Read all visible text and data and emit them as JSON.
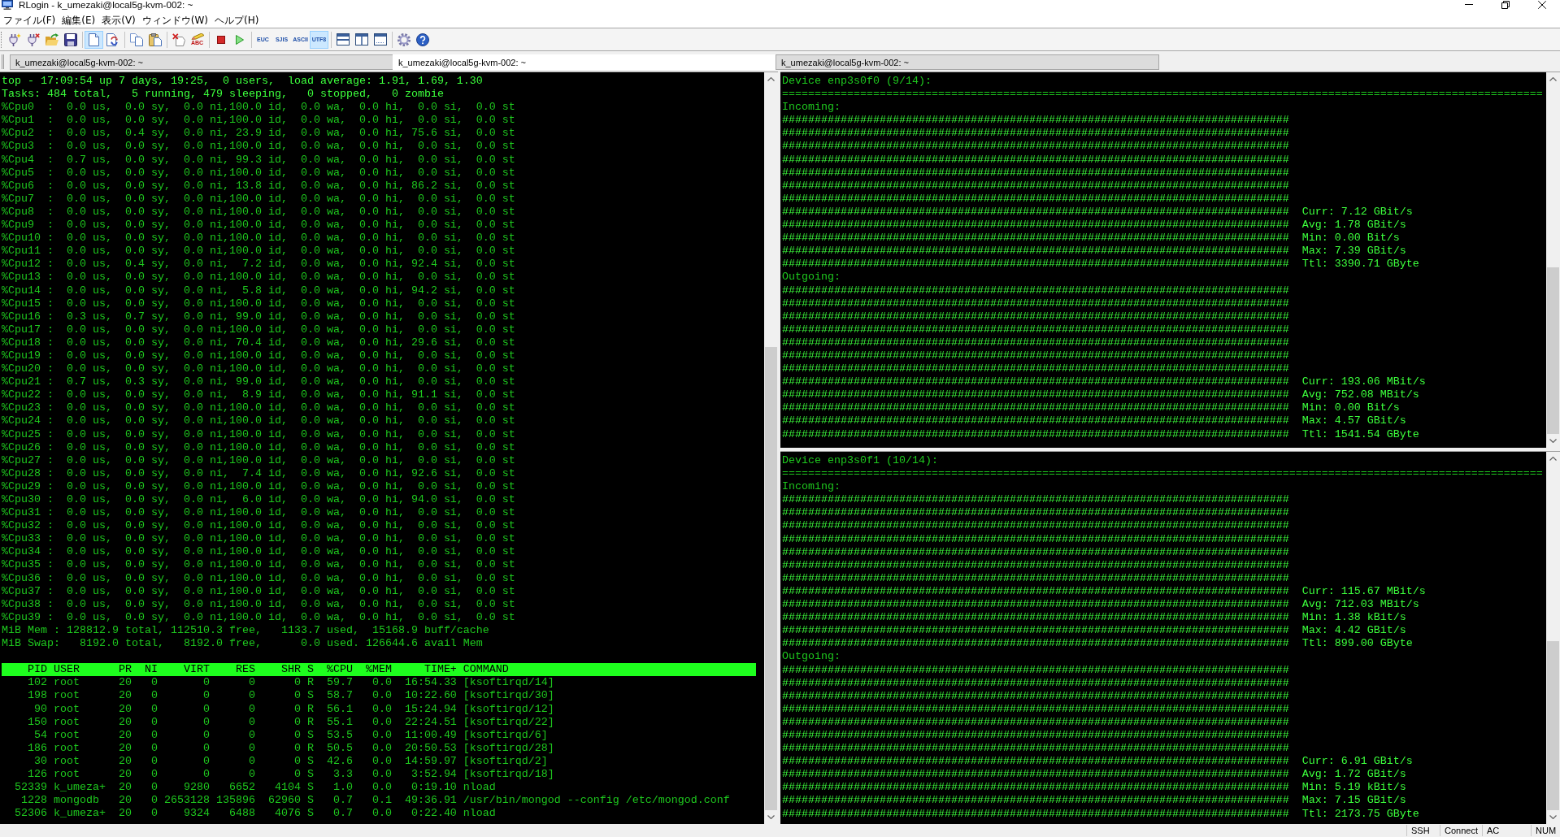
{
  "window": {
    "title": "RLogin - k_umezaki@local5g-kvm-002: ~"
  },
  "menu": [
    "ファイル(F)",
    "編集(E)",
    "表示(V)",
    "ウィンドウ(W)",
    "ヘルプ(H)"
  ],
  "toolbar": [
    {
      "buttons": [
        {
          "kind": "icon",
          "pressed": false
        },
        {
          "kind": "icon",
          "pressed": false
        },
        {
          "kind": "icon",
          "pressed": false
        },
        {
          "kind": "icon",
          "pressed": false
        }
      ]
    },
    {
      "buttons": [
        {
          "kind": "icon",
          "pressed": true
        },
        {
          "kind": "icon",
          "pressed": false
        }
      ]
    },
    {
      "buttons": [
        {
          "kind": "icon",
          "pressed": false
        },
        {
          "kind": "icon",
          "pressed": false
        }
      ]
    },
    {
      "buttons": [
        {
          "kind": "icon",
          "pressed": false
        },
        {
          "kind": "icon",
          "label": "ABC",
          "pressed": false
        }
      ]
    },
    {
      "buttons": [
        {
          "kind": "icon",
          "pressed": false
        },
        {
          "kind": "icon",
          "pressed": false
        }
      ]
    },
    {
      "buttons": [
        {
          "kind": "label",
          "label": "EUC",
          "pressed": false
        },
        {
          "kind": "label",
          "label": "SJIS",
          "pressed": false
        },
        {
          "kind": "label",
          "label": "ASCII",
          "pressed": false
        },
        {
          "kind": "label",
          "label": "UTF8",
          "pressed": true
        }
      ]
    },
    {
      "buttons": [
        {
          "kind": "icon",
          "pressed": false
        },
        {
          "kind": "icon",
          "pressed": false
        },
        {
          "kind": "icon",
          "pressed": false
        }
      ]
    },
    {
      "buttons": [
        {
          "kind": "icon",
          "pressed": false
        },
        {
          "kind": "icon",
          "pressed": false
        }
      ]
    }
  ],
  "tabs": [
    {
      "label": "k_umezaki@local5g-kvm-002: ~",
      "selected": false
    },
    {
      "label": "k_umezaki@local5g-kvm-002: ~",
      "selected": true
    },
    {
      "label": "k_umezaki@local5g-kvm-002: ~",
      "selected": false
    }
  ],
  "top_pane": {
    "summary": [
      "top - 17:09:54 up 7 days, 19:25,  0 users,  load average: 1.91, 1.69, 1.30",
      "Tasks: 484 total,   5 running, 479 sleeping,   0 stopped,   0 zombie"
    ],
    "cpu_lines": [
      "%Cpu0  :  0.0 us,  0.0 sy,  0.0 ni,100.0 id,  0.0 wa,  0.0 hi,  0.0 si,  0.0 st",
      "%Cpu1  :  0.0 us,  0.0 sy,  0.0 ni,100.0 id,  0.0 wa,  0.0 hi,  0.0 si,  0.0 st",
      "%Cpu2  :  0.0 us,  0.4 sy,  0.0 ni, 23.9 id,  0.0 wa,  0.0 hi, 75.6 si,  0.0 st",
      "%Cpu3  :  0.0 us,  0.0 sy,  0.0 ni,100.0 id,  0.0 wa,  0.0 hi,  0.0 si,  0.0 st",
      "%Cpu4  :  0.7 us,  0.0 sy,  0.0 ni, 99.3 id,  0.0 wa,  0.0 hi,  0.0 si,  0.0 st",
      "%Cpu5  :  0.0 us,  0.0 sy,  0.0 ni,100.0 id,  0.0 wa,  0.0 hi,  0.0 si,  0.0 st",
      "%Cpu6  :  0.0 us,  0.0 sy,  0.0 ni, 13.8 id,  0.0 wa,  0.0 hi, 86.2 si,  0.0 st",
      "%Cpu7  :  0.0 us,  0.0 sy,  0.0 ni,100.0 id,  0.0 wa,  0.0 hi,  0.0 si,  0.0 st",
      "%Cpu8  :  0.0 us,  0.0 sy,  0.0 ni,100.0 id,  0.0 wa,  0.0 hi,  0.0 si,  0.0 st",
      "%Cpu9  :  0.0 us,  0.0 sy,  0.0 ni,100.0 id,  0.0 wa,  0.0 hi,  0.0 si,  0.0 st",
      "%Cpu10 :  0.0 us,  0.0 sy,  0.0 ni,100.0 id,  0.0 wa,  0.0 hi,  0.0 si,  0.0 st",
      "%Cpu11 :  0.0 us,  0.0 sy,  0.0 ni,100.0 id,  0.0 wa,  0.0 hi,  0.0 si,  0.0 st",
      "%Cpu12 :  0.0 us,  0.4 sy,  0.0 ni,  7.2 id,  0.0 wa,  0.0 hi, 92.4 si,  0.0 st",
      "%Cpu13 :  0.0 us,  0.0 sy,  0.0 ni,100.0 id,  0.0 wa,  0.0 hi,  0.0 si,  0.0 st",
      "%Cpu14 :  0.0 us,  0.0 sy,  0.0 ni,  5.8 id,  0.0 wa,  0.0 hi, 94.2 si,  0.0 st",
      "%Cpu15 :  0.0 us,  0.0 sy,  0.0 ni,100.0 id,  0.0 wa,  0.0 hi,  0.0 si,  0.0 st",
      "%Cpu16 :  0.3 us,  0.7 sy,  0.0 ni, 99.0 id,  0.0 wa,  0.0 hi,  0.0 si,  0.0 st",
      "%Cpu17 :  0.0 us,  0.0 sy,  0.0 ni,100.0 id,  0.0 wa,  0.0 hi,  0.0 si,  0.0 st",
      "%Cpu18 :  0.0 us,  0.0 sy,  0.0 ni, 70.4 id,  0.0 wa,  0.0 hi, 29.6 si,  0.0 st",
      "%Cpu19 :  0.0 us,  0.0 sy,  0.0 ni,100.0 id,  0.0 wa,  0.0 hi,  0.0 si,  0.0 st",
      "%Cpu20 :  0.0 us,  0.0 sy,  0.0 ni,100.0 id,  0.0 wa,  0.0 hi,  0.0 si,  0.0 st",
      "%Cpu21 :  0.7 us,  0.3 sy,  0.0 ni, 99.0 id,  0.0 wa,  0.0 hi,  0.0 si,  0.0 st",
      "%Cpu22 :  0.0 us,  0.0 sy,  0.0 ni,  8.9 id,  0.0 wa,  0.0 hi, 91.1 si,  0.0 st",
      "%Cpu23 :  0.0 us,  0.0 sy,  0.0 ni,100.0 id,  0.0 wa,  0.0 hi,  0.0 si,  0.0 st",
      "%Cpu24 :  0.0 us,  0.0 sy,  0.0 ni,100.0 id,  0.0 wa,  0.0 hi,  0.0 si,  0.0 st",
      "%Cpu25 :  0.0 us,  0.0 sy,  0.0 ni,100.0 id,  0.0 wa,  0.0 hi,  0.0 si,  0.0 st",
      "%Cpu26 :  0.0 us,  0.0 sy,  0.0 ni,100.0 id,  0.0 wa,  0.0 hi,  0.0 si,  0.0 st",
      "%Cpu27 :  0.0 us,  0.0 sy,  0.0 ni,100.0 id,  0.0 wa,  0.0 hi,  0.0 si,  0.0 st",
      "%Cpu28 :  0.0 us,  0.0 sy,  0.0 ni,  7.4 id,  0.0 wa,  0.0 hi, 92.6 si,  0.0 st",
      "%Cpu29 :  0.0 us,  0.0 sy,  0.0 ni,100.0 id,  0.0 wa,  0.0 hi,  0.0 si,  0.0 st",
      "%Cpu30 :  0.0 us,  0.0 sy,  0.0 ni,  6.0 id,  0.0 wa,  0.0 hi, 94.0 si,  0.0 st",
      "%Cpu31 :  0.0 us,  0.0 sy,  0.0 ni,100.0 id,  0.0 wa,  0.0 hi,  0.0 si,  0.0 st",
      "%Cpu32 :  0.0 us,  0.0 sy,  0.0 ni,100.0 id,  0.0 wa,  0.0 hi,  0.0 si,  0.0 st",
      "%Cpu33 :  0.0 us,  0.0 sy,  0.0 ni,100.0 id,  0.0 wa,  0.0 hi,  0.0 si,  0.0 st",
      "%Cpu34 :  0.0 us,  0.0 sy,  0.0 ni,100.0 id,  0.0 wa,  0.0 hi,  0.0 si,  0.0 st",
      "%Cpu35 :  0.0 us,  0.0 sy,  0.0 ni,100.0 id,  0.0 wa,  0.0 hi,  0.0 si,  0.0 st",
      "%Cpu36 :  0.0 us,  0.0 sy,  0.0 ni,100.0 id,  0.0 wa,  0.0 hi,  0.0 si,  0.0 st",
      "%Cpu37 :  0.0 us,  0.0 sy,  0.0 ni,100.0 id,  0.0 wa,  0.0 hi,  0.0 si,  0.0 st",
      "%Cpu38 :  0.0 us,  0.0 sy,  0.0 ni,100.0 id,  0.0 wa,  0.0 hi,  0.0 si,  0.0 st",
      "%Cpu39 :  0.0 us,  0.0 sy,  0.0 ni,100.0 id,  0.0 wa,  0.0 hi,  0.0 si,  0.0 st"
    ],
    "memory": [
      "MiB Mem : 128812.9 total, 112510.3 free,   1133.7 used,  15168.9 buff/cache",
      "MiB Swap:   8192.0 total,   8192.0 free,      0.0 used. 126644.6 avail Mem"
    ],
    "process_header": "    PID USER      PR  NI    VIRT    RES    SHR S  %CPU  %MEM     TIME+ COMMAND",
    "processes": [
      "    102 root      20   0       0      0      0 R  59.7   0.0  16:54.33 [ksoftirqd/14]",
      "    198 root      20   0       0      0      0 S  58.7   0.0  10:22.60 [ksoftirqd/30]",
      "     90 root      20   0       0      0      0 R  56.1   0.0  15:24.94 [ksoftirqd/12]",
      "    150 root      20   0       0      0      0 R  55.1   0.0  22:24.51 [ksoftirqd/22]",
      "     54 root      20   0       0      0      0 S  53.5   0.0  11:00.49 [ksoftirqd/6]",
      "    186 root      20   0       0      0      0 R  50.5   0.0  20:50.53 [ksoftirqd/28]",
      "     30 root      20   0       0      0      0 S  42.6   0.0  14:59.97 [ksoftirqd/2]",
      "    126 root      20   0       0      0      0 S   3.3   0.0   3:52.94 [ksoftirqd/18]",
      "  52339 k_umeza+  20   0    9280   6652   4104 S   1.0   0.0   0:19.10 nload",
      "   1228 mongodb   20   0 2653128 135896  62960 S   0.7   0.1  49:36.91 /usr/bin/mongod --config /etc/mongod.conf",
      "  52306 k_umeza+  20   0    9324   6488   4076 S   0.7   0.0   0:22.40 nload"
    ]
  },
  "nload_panes": [
    {
      "device": "Device enp3s0f0 (9/14):",
      "rule": "=====================================================================================================================",
      "sections": [
        {
          "label": "Incoming:",
          "graph": [
            "##############################################################################",
            "##############################################################################",
            "##############################################################################",
            "##############################################################################",
            "##############################################################################",
            "##############################################################################",
            "##############################################################################",
            "##############################################################################",
            "##############################################################################",
            "##############################################################################",
            "##############################################################################",
            "##############################################################################"
          ],
          "stats": [
            "Curr: 7.12 GBit/s",
            "Avg: 1.78 GBit/s",
            "Min: 0.00 Bit/s",
            "Max: 7.39 GBit/s",
            "Ttl: 3390.71 GByte"
          ]
        },
        {
          "label": "Outgoing:",
          "graph": [
            "##############################################################################",
            "##############################################################################",
            "##############################################################################",
            "##############################################################################",
            "##############################################################################",
            "##############################################################################",
            "##############################################################################",
            "##############################################################################",
            "##############################################################################",
            "##############################################################################",
            "##############################################################################",
            "##############################################################################"
          ],
          "stats": [
            "Curr: 193.06 MBit/s",
            "Avg: 752.08 MBit/s",
            "Min: 0.00 Bit/s",
            "Max: 4.57 GBit/s",
            "Ttl: 1541.54 GByte"
          ]
        }
      ]
    },
    {
      "device": "Device enp3s0f1 (10/14):",
      "rule": "=====================================================================================================================",
      "sections": [
        {
          "label": "Incoming:",
          "graph": [
            "##############################################################################",
            "##############################################################################",
            "##############################################################################",
            "##############################################################################",
            "##############################################################################",
            "##############################################################################",
            "##############################################################################",
            "##############################################################################",
            "##############################################################################",
            "##############################################################################",
            "##############################################################################",
            "##############################################################################"
          ],
          "stats": [
            "Curr: 115.67 MBit/s",
            "Avg: 712.03 MBit/s",
            "Min: 1.38 kBit/s",
            "Max: 4.42 GBit/s",
            "Ttl: 899.00 GByte"
          ]
        },
        {
          "label": "Outgoing:",
          "graph": [
            "##############################################################################",
            "##############################################################################",
            "##############################################################################",
            "##############################################################################",
            "##############################################################################",
            "##############################################################################",
            "##############################################################################",
            "##############################################################################",
            "##############################################################################",
            "##############################################################################",
            "##############################################################################",
            "##############################################################################"
          ],
          "stats": [
            "Curr: 6.91 GBit/s",
            "Avg: 1.72 GBit/s",
            "Min: 5.19 kBit/s",
            "Max: 7.15 GBit/s",
            "Ttl: 2173.75 GByte"
          ]
        }
      ]
    }
  ],
  "status_bar": [
    "SSH",
    "Connect",
    "AC",
    "NUM"
  ]
}
